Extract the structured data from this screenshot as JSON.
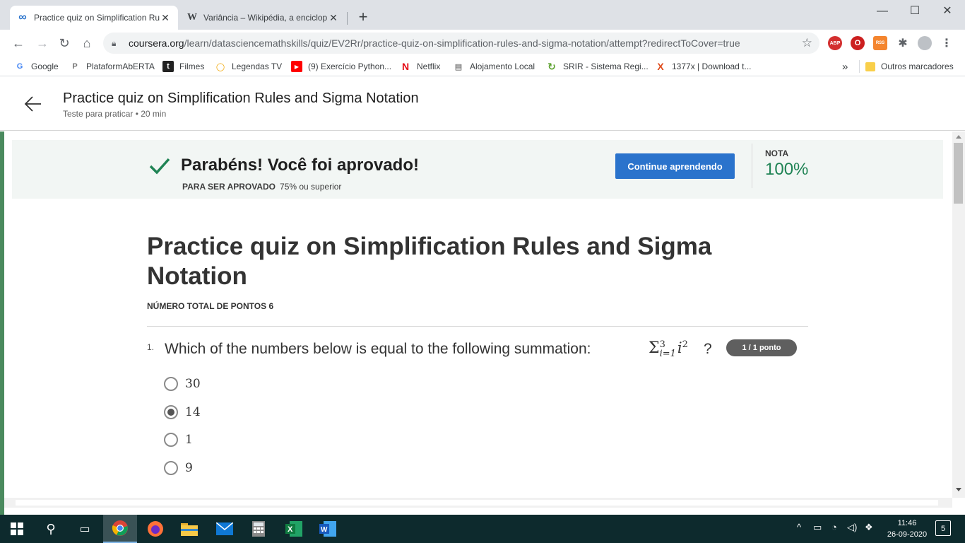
{
  "browser": {
    "tabs": [
      {
        "title": "Practice quiz on Simplification Ru",
        "favicon": "∞"
      },
      {
        "title": "Variância – Wikipédia, a enciclop",
        "favicon": "W"
      }
    ],
    "url_host": "coursera.org",
    "url_path": "/learn/datasciencemathskills/quiz/EV2Rr/practice-quiz-on-simplification-rules-and-sigma-notation/attempt?redirectToCover=true",
    "extensions": [
      {
        "label": "ABP",
        "color": "#d32f2f"
      },
      {
        "label": "O",
        "color": "#cc1f1f"
      },
      {
        "label": "RSS",
        "color": "#f4852e"
      }
    ],
    "bookmarks": [
      {
        "label": "Google",
        "icon": "G",
        "color": "#4285f4"
      },
      {
        "label": "PlataformAbERTA",
        "icon": "P",
        "color": "#777777"
      },
      {
        "label": "Filmes",
        "icon": "t",
        "color": "#222222"
      },
      {
        "label": "Legendas TV",
        "icon": "◯",
        "color": "#f0a500"
      },
      {
        "label": "(9) Exercício Python...",
        "icon": "▶",
        "color": "#ff0000"
      },
      {
        "label": "Netflix",
        "icon": "N",
        "color": "#e50914"
      },
      {
        "label": "Alojamento Local",
        "icon": "▤",
        "color": "#444444"
      },
      {
        "label": "SRIR - Sistema Regi...",
        "icon": "↻",
        "color": "#5aa02c"
      },
      {
        "label": "1377x | Download t...",
        "icon": "X",
        "color": "#e04e1f"
      }
    ],
    "bookmarks_overflow": "»",
    "other_bookmarks": "Outros marcadores"
  },
  "page_header": {
    "title": "Practice quiz on Simplification Rules and Sigma Notation",
    "subtitle": "Teste para praticar • 20 min"
  },
  "result_banner": {
    "message": "Parabéns! Você foi aprovado!",
    "pass_label": "PARA SER APROVADO",
    "pass_value": "75% ou superior",
    "continue_button": "Continue aprendendo",
    "grade_label": "NOTA",
    "grade_value": "100%"
  },
  "quiz": {
    "heading": "Practice quiz on Simplification Rules and Sigma Notation",
    "total_points": "NÚMERO TOTAL DE PONTOS 6",
    "question": {
      "number": "1.",
      "text": "Which of the numbers below is equal to the following summation:",
      "math_sigma": "Σ",
      "math_upper": "3",
      "math_lower": "i=1",
      "math_var": "i",
      "math_exp": "2",
      "qmark": "?",
      "points": "1 / 1 ponto",
      "options": [
        "30",
        "14",
        "1",
        "9"
      ],
      "selected_index": 1
    }
  },
  "taskbar": {
    "time": "11:46",
    "date": "26-09-2020",
    "notification_count": "5"
  }
}
